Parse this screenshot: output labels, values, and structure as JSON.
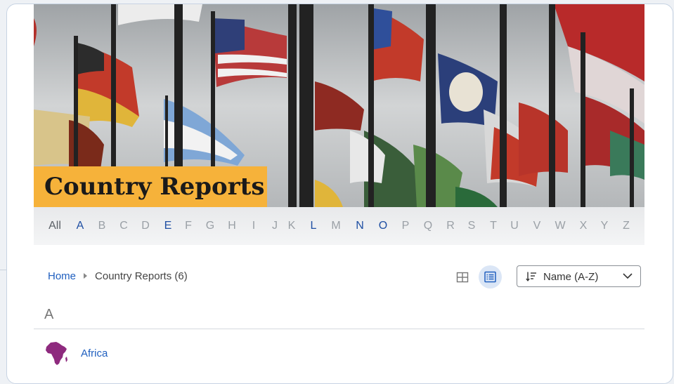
{
  "hero": {
    "title": "Country Reports"
  },
  "alphabet": {
    "items": [
      {
        "label": "All",
        "state": "all"
      },
      {
        "label": "A",
        "state": "active"
      },
      {
        "label": "B",
        "state": "inactive"
      },
      {
        "label": "C",
        "state": "inactive"
      },
      {
        "label": "D",
        "state": "inactive"
      },
      {
        "label": "E",
        "state": "active"
      },
      {
        "label": "F",
        "state": "inactive"
      },
      {
        "label": "G",
        "state": "inactive"
      },
      {
        "label": "H",
        "state": "inactive"
      },
      {
        "label": "I",
        "state": "inactive"
      },
      {
        "label": "J",
        "state": "inactive"
      },
      {
        "label": "K",
        "state": "inactive"
      },
      {
        "label": "L",
        "state": "active"
      },
      {
        "label": "M",
        "state": "inactive"
      },
      {
        "label": "N",
        "state": "active"
      },
      {
        "label": "O",
        "state": "active"
      },
      {
        "label": "P",
        "state": "inactive"
      },
      {
        "label": "Q",
        "state": "inactive"
      },
      {
        "label": "R",
        "state": "inactive"
      },
      {
        "label": "S",
        "state": "inactive"
      },
      {
        "label": "T",
        "state": "inactive"
      },
      {
        "label": "U",
        "state": "inactive"
      },
      {
        "label": "V",
        "state": "inactive"
      },
      {
        "label": "W",
        "state": "inactive"
      },
      {
        "label": "X",
        "state": "inactive"
      },
      {
        "label": "Y",
        "state": "inactive"
      },
      {
        "label": "Z",
        "state": "inactive"
      }
    ]
  },
  "breadcrumb": {
    "home": "Home",
    "current": "Country Reports (6)"
  },
  "view_toggle": {
    "grid_icon": "grid-view-icon",
    "list_icon": "list-view-icon",
    "selected": "list"
  },
  "sort": {
    "label": "Name (A-Z)",
    "icon": "sort-icon"
  },
  "groups": [
    {
      "letter": "A",
      "items": [
        {
          "label": "Africa",
          "icon": "africa-map-icon"
        }
      ]
    }
  ],
  "colors": {
    "accent": "#f6b23a",
    "link": "#1f5fbf",
    "active_letter": "#1f4fa3",
    "africa_icon": "#8e2a7e"
  }
}
